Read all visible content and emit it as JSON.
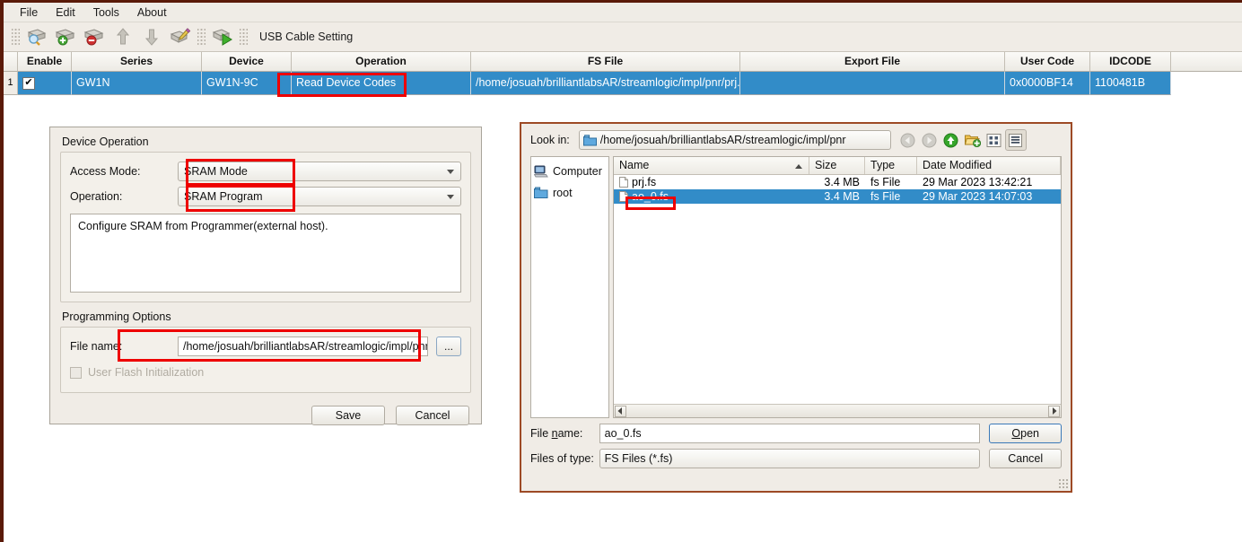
{
  "menubar": {
    "items": [
      "File",
      "Edit",
      "Tools",
      "About"
    ]
  },
  "toolbar": {
    "buttons": [
      {
        "name": "scan-device-icon",
        "title": "Scan Device"
      },
      {
        "name": "add-device-icon",
        "title": "Add Device"
      },
      {
        "name": "remove-device-icon",
        "title": "Remove Device"
      },
      {
        "name": "move-up-icon",
        "title": "Move Up"
      },
      {
        "name": "move-down-icon",
        "title": "Move Down"
      },
      {
        "name": "edit-device-icon",
        "title": "Edit Device"
      },
      {
        "name": "program-run-icon",
        "title": "Program/Configure"
      }
    ],
    "usb_cable_setting": "USB Cable Setting"
  },
  "device_table": {
    "columns": [
      "Enable",
      "Series",
      "Device",
      "Operation",
      "FS File",
      "Export File",
      "User Code",
      "IDCODE"
    ],
    "rows": [
      {
        "num": "1",
        "enable": true,
        "enable_mark": "✔",
        "series": "GW1N",
        "device": "GW1N-9C",
        "operation": "Read Device Codes",
        "fs_file": "/home/josuah/brilliantlabsAR/streamlogic/impl/pnr/prj.fs",
        "export_file": "",
        "user_code": "0x0000BF14",
        "idcode": "1100481B"
      }
    ]
  },
  "device_panel": {
    "title": "Device Operation",
    "access_mode_label": "Access Mode:",
    "access_mode_value": "SRAM Mode",
    "operation_label": "Operation:",
    "operation_value": "SRAM Program",
    "description": "Configure SRAM from Programmer(external host).",
    "programming_options_title": "Programming Options",
    "file_name_label": "File name:",
    "file_name_value": "/home/josuah/brilliantlabsAR/streamlogic/impl/pnr/prj.fs",
    "browse_label": "...",
    "user_flash_label": "User Flash Initialization",
    "user_flash_checked": false,
    "save_label": "Save",
    "cancel_label": "Cancel"
  },
  "file_dialog": {
    "look_in_label": "Look in:",
    "look_in_value": "/home/josuah/brilliantlabsAR/streamlogic/impl/pnr",
    "nav_buttons": [
      {
        "name": "back-icon",
        "enabled": false
      },
      {
        "name": "forward-icon",
        "enabled": false
      },
      {
        "name": "parent-directory-icon",
        "enabled": true
      },
      {
        "name": "new-folder-icon",
        "enabled": true
      },
      {
        "name": "list-view-icon",
        "enabled": true
      },
      {
        "name": "detail-view-icon",
        "enabled": true
      }
    ],
    "sidebar": [
      {
        "label": "Computer",
        "icon": "computer-icon"
      },
      {
        "label": "root",
        "icon": "folder-icon"
      }
    ],
    "columns": [
      "Name",
      "Size",
      "Type",
      "Date Modified"
    ],
    "sort_column": "Name",
    "files": [
      {
        "name": "prj.fs",
        "size": "3.4 MB",
        "type": "fs File",
        "date": "29 Mar 2023 13:42:21",
        "selected": false
      },
      {
        "name": "ao_0.fs",
        "size": "3.4 MB",
        "type": "fs File",
        "date": "29 Mar 2023 14:07:03",
        "selected": true
      }
    ],
    "file_name_label_pre": "File ",
    "file_name_label_mn": "n",
    "file_name_label_post": "ame:",
    "file_name_value": "ao_0.fs",
    "files_of_type_label": "Files of type:",
    "files_of_type_value": "FS Files (*.fs)",
    "open_label_mn": "O",
    "open_label_post": "pen",
    "cancel_label": "Cancel"
  },
  "colors": {
    "selection_blue": "#328cc8",
    "annotation_red": "#ee0000",
    "window_border": "#5a1a08",
    "dialog_border": "#9d4a25",
    "panel_bg": "#f0ece6"
  }
}
